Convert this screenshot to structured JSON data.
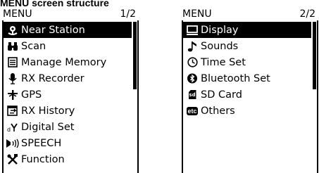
{
  "page_title": "MENU screen structure",
  "screen1": {
    "title": "MENU",
    "page": "1/2",
    "items": [
      {
        "label": "Near Station",
        "icon": "near-station-icon",
        "selected": true
      },
      {
        "label": "Scan",
        "icon": "binoculars-icon",
        "selected": false
      },
      {
        "label": "Manage Memory",
        "icon": "memory-document-icon",
        "selected": false
      },
      {
        "label": "RX Recorder",
        "icon": "microphone-icon",
        "selected": false
      },
      {
        "label": "GPS",
        "icon": "gps-antenna-icon",
        "selected": false
      },
      {
        "label": "RX History",
        "icon": "rx-history-icon",
        "selected": false
      },
      {
        "label": "Digital Set",
        "icon": "digital-set-icon",
        "selected": false
      },
      {
        "label": "SPEECH",
        "icon": "speech-icon",
        "selected": false
      },
      {
        "label": "Function",
        "icon": "tools-icon",
        "selected": false
      }
    ]
  },
  "screen2": {
    "title": "MENU",
    "page": "2/2",
    "items": [
      {
        "label": "Display",
        "icon": "monitor-icon",
        "selected": true
      },
      {
        "label": "Sounds",
        "icon": "music-note-icon",
        "selected": false
      },
      {
        "label": "Time Set",
        "icon": "clock-icon",
        "selected": false
      },
      {
        "label": "Bluetooth Set",
        "icon": "bluetooth-icon",
        "selected": false
      },
      {
        "label": "SD Card",
        "icon": "sd-card-icon",
        "selected": false
      },
      {
        "label": "Others",
        "icon": "etc-icon",
        "icon_text": "etc",
        "selected": false
      }
    ]
  }
}
